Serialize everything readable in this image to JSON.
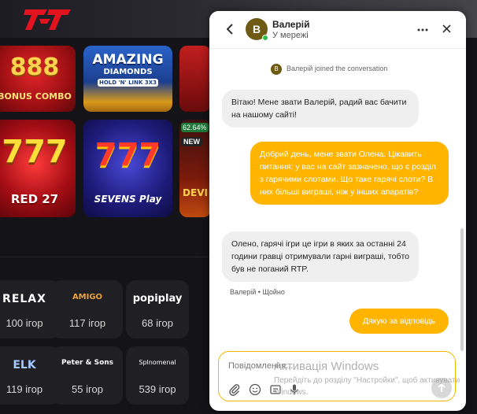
{
  "casino": {
    "tiles": [
      {
        "label": "888",
        "sub": "BONUS COMBO"
      },
      {
        "label": "AMAZING",
        "sub": "DIAMONDS",
        "extra": "HOLD 'N' LINK 3X3"
      },
      {
        "label": "777",
        "sub": "RED 27"
      },
      {
        "label": "777",
        "sub": "SEVENS Play"
      },
      {
        "badge": "62.64%",
        "badge2": "NEW",
        "label": "DEVI"
      }
    ],
    "providers": [
      {
        "name": "RELAX",
        "count": "100 ігор"
      },
      {
        "name": "AMIGO",
        "count": "117 ігор"
      },
      {
        "name": "popiplay",
        "count": "68 ігор"
      },
      {
        "name": "ELK",
        "count": "119 ігор"
      },
      {
        "name": "Peter & Sons",
        "count": "55 ігор"
      },
      {
        "name": "Splnomenal",
        "count": "539 ігор"
      }
    ]
  },
  "chat": {
    "header": {
      "avatar_letter": "B",
      "agent_name": "Валерій",
      "status": "У мережі"
    },
    "joined": {
      "avatar_letter": "B",
      "name": "Валерій",
      "text": "joined the conversation"
    },
    "messages": [
      {
        "from": "agent",
        "text": "Вітаю! Мене звати Валерій, радий вас бачити на нашому сайті!"
      },
      {
        "from": "user",
        "text": "Добрий день, мене звати Олена. Цікавить питання: у вас на сайт зазначено, що є розділ з гарячими слотами. Що таке гарячі слоти? В них більші виграші, ніж у інших апаратів?"
      },
      {
        "from": "agent",
        "text": "Олено, гарячі ігри це ігри в яких за останні 24 години гравці отримували гарні виграші, тобто був не поганий RTP."
      },
      {
        "from": "user",
        "text": "Дякую за відповідь"
      }
    ],
    "agent_meta": "Валерій • Щойно",
    "composer": {
      "placeholder": "Повідомлення..."
    }
  },
  "watermark": {
    "title": "Активація Windows",
    "subtitle": "Перейдіть до розділу \"Настройки\", щоб активувати Windows."
  },
  "colors": {
    "accent": "#ffb400",
    "online": "#2bbf4a",
    "avatar": "#6e5a12"
  }
}
